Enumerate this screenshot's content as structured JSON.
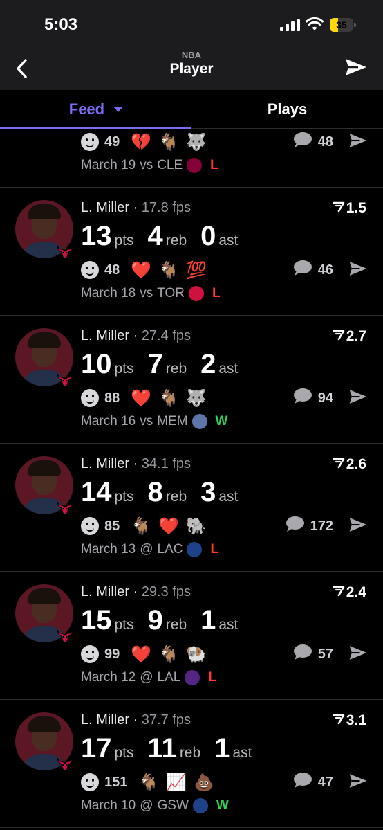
{
  "status": {
    "time": "5:03",
    "battery": "35",
    "battery_level": 0.35
  },
  "header": {
    "league": "NBA",
    "title": "Player"
  },
  "tabs": [
    {
      "label": "Feed"
    },
    {
      "label": "Plays"
    }
  ],
  "feed": [
    {
      "player": "",
      "fps": "",
      "trend": "",
      "stats": [],
      "reactions": [
        {
          "count": "49"
        }
      ],
      "emojis": [
        "💔",
        "🐐",
        "🐺"
      ],
      "comments": "48",
      "date": "March 19",
      "venue": "vs",
      "opponent": "CLE",
      "result": "L",
      "partial": true
    },
    {
      "player": "L. Miller",
      "fps": "17.8 fps",
      "trend": "1.5",
      "stats": [
        {
          "value": "13",
          "label": "pts"
        },
        {
          "value": "4",
          "label": "reb"
        },
        {
          "value": "0",
          "label": "ast"
        }
      ],
      "reactions": [
        {
          "count": "48"
        }
      ],
      "emojis": [
        "❤️",
        "🐐",
        "💯"
      ],
      "comments": "46",
      "date": "March 18",
      "venue": "vs",
      "opponent": "TOR",
      "result": "L"
    },
    {
      "player": "L. Miller",
      "fps": "27.4 fps",
      "trend": "2.7",
      "stats": [
        {
          "value": "10",
          "label": "pts"
        },
        {
          "value": "7",
          "label": "reb"
        },
        {
          "value": "2",
          "label": "ast"
        }
      ],
      "reactions": [
        {
          "count": "88"
        }
      ],
      "emojis": [
        "❤️",
        "🐐",
        "🐺"
      ],
      "comments": "94",
      "date": "March 16",
      "venue": "vs",
      "opponent": "MEM",
      "result": "W"
    },
    {
      "player": "L. Miller",
      "fps": "34.1 fps",
      "trend": "2.6",
      "stats": [
        {
          "value": "14",
          "label": "pts"
        },
        {
          "value": "8",
          "label": "reb"
        },
        {
          "value": "3",
          "label": "ast"
        }
      ],
      "reactions": [
        {
          "count": "85"
        }
      ],
      "emojis": [
        "🐐",
        "❤️",
        "🐘"
      ],
      "comments": "172",
      "date": "March 13",
      "venue": "@",
      "opponent": "LAC",
      "result": "L"
    },
    {
      "player": "L. Miller",
      "fps": "29.3 fps",
      "trend": "2.4",
      "stats": [
        {
          "value": "15",
          "label": "pts"
        },
        {
          "value": "9",
          "label": "reb"
        },
        {
          "value": "1",
          "label": "ast"
        }
      ],
      "reactions": [
        {
          "count": "99"
        }
      ],
      "emojis": [
        "❤️",
        "🐐",
        "🐏"
      ],
      "comments": "57",
      "date": "March 12",
      "venue": "@",
      "opponent": "LAL",
      "result": "L"
    },
    {
      "player": "L. Miller",
      "fps": "37.7 fps",
      "trend": "3.1",
      "stats": [
        {
          "value": "17",
          "label": "pts"
        },
        {
          "value": "11",
          "label": "reb"
        },
        {
          "value": "1",
          "label": "ast"
        }
      ],
      "reactions": [
        {
          "count": "151"
        }
      ],
      "emojis": [
        "🐐",
        "📈",
        "💩"
      ],
      "comments": "47",
      "date": "March 10",
      "venue": "@",
      "opponent": "GSW",
      "result": "W"
    }
  ],
  "team_colors": {
    "CLE": "#860038",
    "TOR": "#ce1141",
    "MEM": "#5d76a9",
    "LAC": "#1d428a",
    "LAL": "#552583",
    "GSW": "#1d428a"
  },
  "icons": {
    "back": "chevron-left-icon",
    "send": "paper-plane-icon",
    "comment": "speech-bubble-icon",
    "trend": "trend-arrow-icon",
    "team": "bulls-logo-icon"
  },
  "accent": "#7b6cf6"
}
